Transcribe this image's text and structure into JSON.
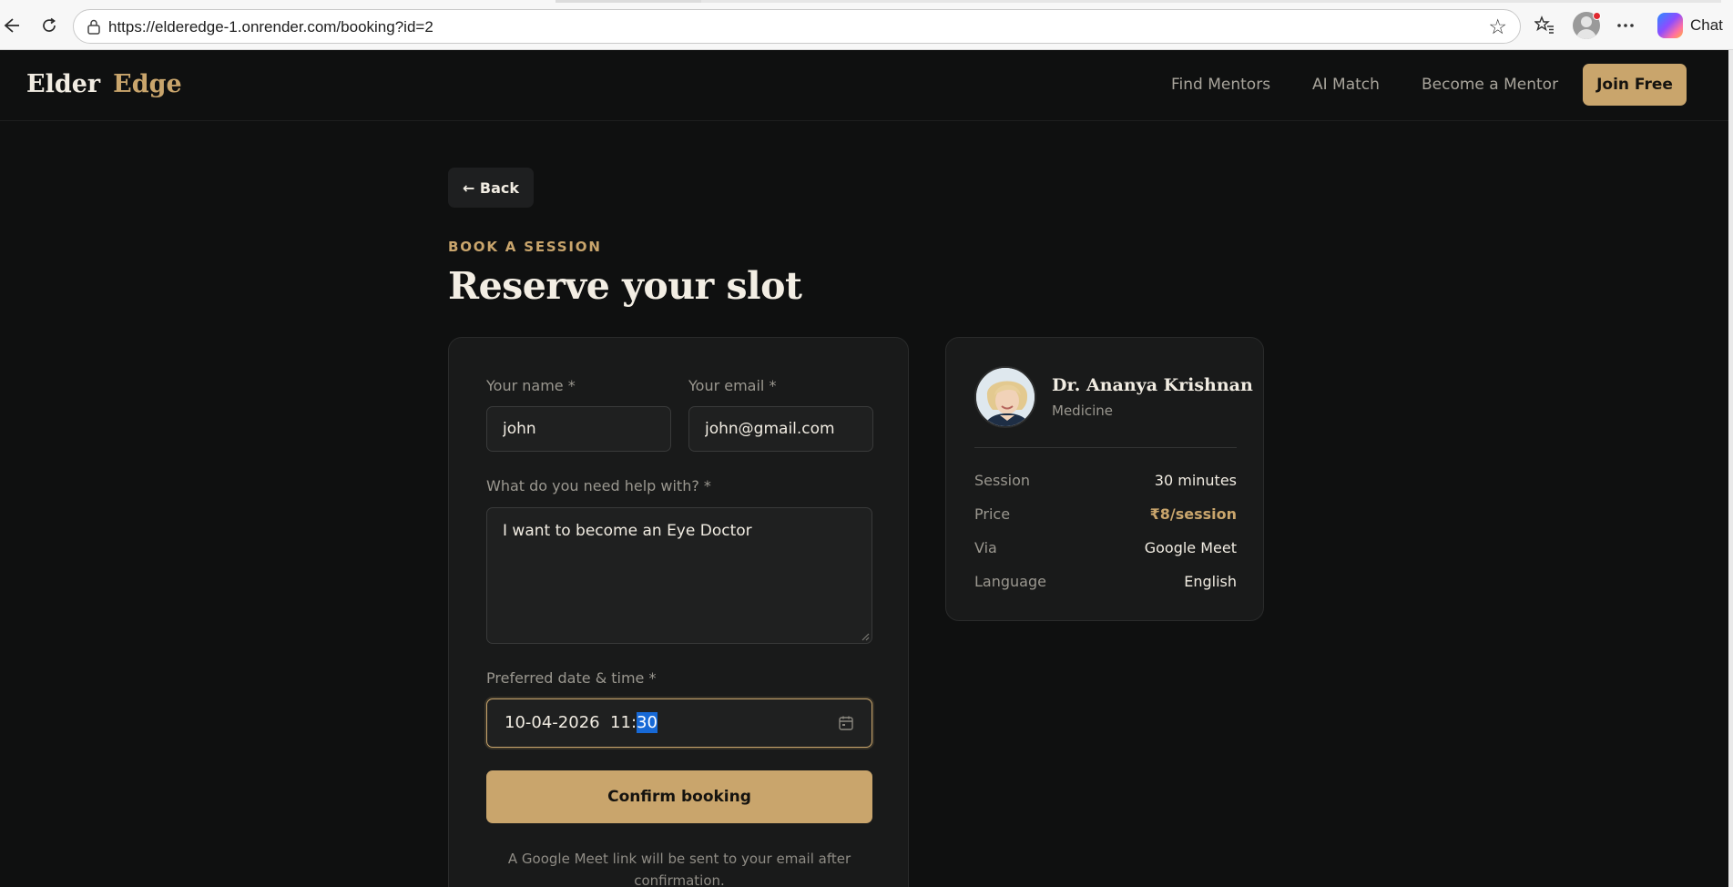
{
  "browser": {
    "url": "https://elderedge-1.onrender.com/booking?id=2",
    "chat_label": "Chat"
  },
  "site": {
    "brand_first": "Elder",
    "brand_second": "Edge",
    "nav": [
      "Find Mentors",
      "AI Match",
      "Become a Mentor"
    ],
    "cta": "Join Free"
  },
  "page": {
    "back_label": "← Back",
    "eyebrow": "BOOK A SESSION",
    "title": "Reserve your slot"
  },
  "form": {
    "name_label": "Your name *",
    "name_value": "john",
    "email_label": "Your email *",
    "email_value": "john@gmail.com",
    "help_label": "What do you need help with? *",
    "help_value": "I want to become an Eye Doctor",
    "datetime_label": "Preferred date & time *",
    "datetime_prefix": "10-04-2026  11:",
    "datetime_selected": "30",
    "submit_label": "Confirm booking",
    "footnote": "A Google Meet link will be sent to your email after confirmation."
  },
  "mentor": {
    "name": "Dr. Ananya Krishnan",
    "field": "Medicine",
    "details": [
      {
        "key": "Session",
        "value": "30 minutes"
      },
      {
        "key": "Price",
        "value": "₹8/session"
      },
      {
        "key": "Via",
        "value": "Google Meet"
      },
      {
        "key": "Language",
        "value": "English"
      }
    ]
  },
  "colors": {
    "accent": "#c9a56c",
    "background": "#0f1010",
    "card": "#191a1a",
    "selection": "#1769d6"
  },
  "icons": [
    "back-arrow-icon",
    "refresh-icon",
    "lock-icon",
    "star-icon",
    "favorites-icon",
    "more-icon",
    "copilot-icon",
    "calendar-icon"
  ]
}
